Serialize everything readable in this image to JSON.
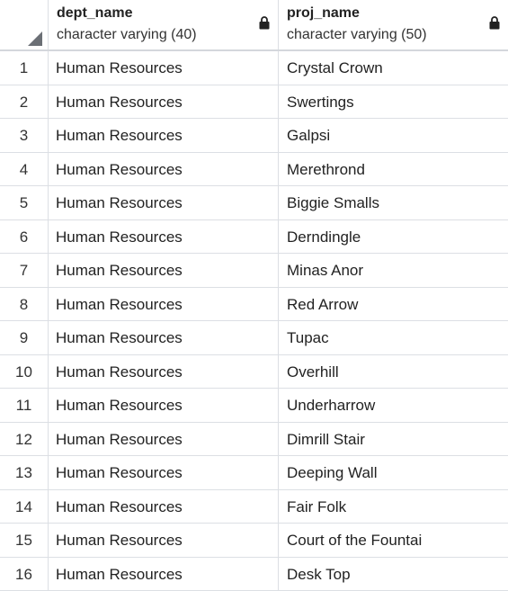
{
  "columns": [
    {
      "name": "dept_name",
      "type": "character varying (40)",
      "icon": "lock-icon"
    },
    {
      "name": "proj_name",
      "type": "character varying (50)",
      "icon": "lock-icon"
    }
  ],
  "rows": [
    {
      "index": "1",
      "dept_name": "Human Resources",
      "proj_name": "Crystal Crown"
    },
    {
      "index": "2",
      "dept_name": "Human Resources",
      "proj_name": "Swertings"
    },
    {
      "index": "3",
      "dept_name": "Human Resources",
      "proj_name": "Galpsi"
    },
    {
      "index": "4",
      "dept_name": "Human Resources",
      "proj_name": "Merethrond"
    },
    {
      "index": "5",
      "dept_name": "Human Resources",
      "proj_name": "Biggie Smalls"
    },
    {
      "index": "6",
      "dept_name": "Human Resources",
      "proj_name": "Derndingle"
    },
    {
      "index": "7",
      "dept_name": "Human Resources",
      "proj_name": "Minas Anor"
    },
    {
      "index": "8",
      "dept_name": "Human Resources",
      "proj_name": "Red Arrow"
    },
    {
      "index": "9",
      "dept_name": "Human Resources",
      "proj_name": "Tupac"
    },
    {
      "index": "10",
      "dept_name": "Human Resources",
      "proj_name": "Overhill"
    },
    {
      "index": "11",
      "dept_name": "Human Resources",
      "proj_name": "Underharrow"
    },
    {
      "index": "12",
      "dept_name": "Human Resources",
      "proj_name": "Dimrill Stair"
    },
    {
      "index": "13",
      "dept_name": "Human Resources",
      "proj_name": "Deeping Wall"
    },
    {
      "index": "14",
      "dept_name": "Human Resources",
      "proj_name": "Fair Folk"
    },
    {
      "index": "15",
      "dept_name": "Human Resources",
      "proj_name": "Court of the Fountai"
    },
    {
      "index": "16",
      "dept_name": "Human Resources",
      "proj_name": "Desk Top"
    }
  ]
}
